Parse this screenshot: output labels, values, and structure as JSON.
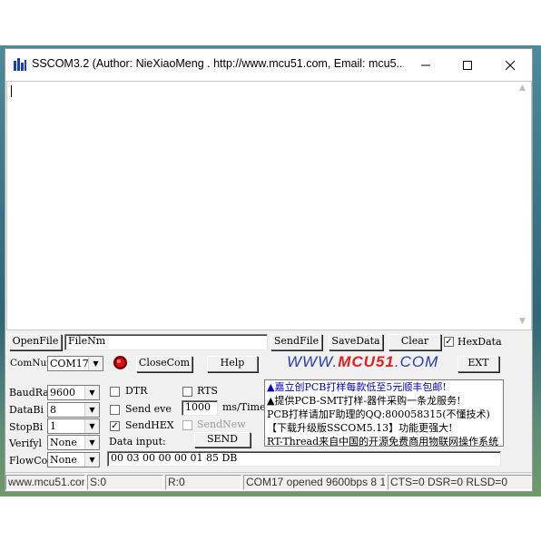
{
  "window": {
    "title": "SSCOM3.2 (Author: NieXiaoMeng .  http://www.mcu51.com,  Email: mcu5..."
  },
  "file_row": {
    "open_file_label": "OpenFile",
    "file_name_value": "FileNm",
    "send_file_label": "SendFile",
    "save_data_label": "SaveData",
    "clear_label": "Clear",
    "hexdata_label": "HexData",
    "hexdata_checked": true
  },
  "com_row": {
    "comnum_label": "ComNum",
    "comnum_value": "COM17",
    "close_com_label": "CloseCom",
    "help_label": "Help",
    "ext_label": "EXT",
    "logo_prefix": "WWW.",
    "logo_brand": "MCU51",
    "logo_suffix": ".COM"
  },
  "serial_settings": {
    "baudrate_label": "BaudRa",
    "baudrate_value": "9600",
    "databits_label": "DataBi",
    "databits_value": "8",
    "stopbits_label": "StopBi",
    "stopbits_value": "1",
    "verify_label": "Verifyl",
    "verify_value": "None",
    "flowctrl_label": "FlowCo",
    "flowctrl_value": "None"
  },
  "send_options": {
    "dtr_label": "DTR",
    "rts_label": "RTS",
    "send_every_label": "Send eve",
    "interval_value": "1000",
    "interval_unit": "ms/Time",
    "sendhex_label": "SendHEX",
    "sendhex_checked": true,
    "sendnew_label": "SendNew",
    "data_input_label": "Data input:",
    "send_label": "SEND",
    "data_input_value": "00 03 00 00 00 01 85 DB"
  },
  "ad_lines": [
    "▲嘉立创PCB打样每款低至5元顺丰包邮!",
    "▲提供PCB-SMT打样-器件采购一条龙服务!",
    "PCB打样请加F助理的QQ:800058315(不懂技术)",
    "【下载升级版SSCOM5.13】功能更强大!",
    "RT-Thread来自中国的开源免费商用物联网操作系统"
  ],
  "status_bar": {
    "url": "www.mcu51.con",
    "sent": "S:0",
    "received": "R:0",
    "port_status": "COM17 opened 9600bps  8 1",
    "line_status": "CTS=0 DSR=0 RLSD=0"
  },
  "colors": {
    "ad_blue": "#0000cc",
    "ad_red": "#d00000",
    "logo_blue": "#2a3bb0",
    "logo_red": "#e02020"
  }
}
